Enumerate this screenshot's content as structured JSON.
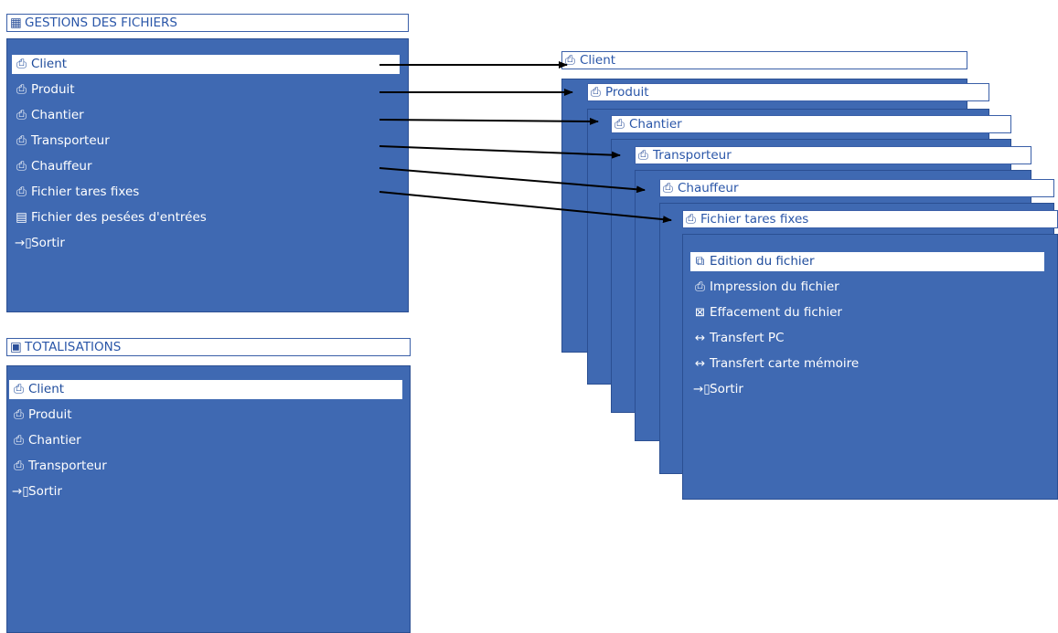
{
  "colors": {
    "panel": "#3f69b2",
    "title_text": "#2a56a8",
    "selection": "#ffffff",
    "arrow": "#000000"
  },
  "gestions": {
    "title": "GESTIONS DES FICHIERS",
    "title_icon": "files-icon",
    "items": [
      {
        "label": "Client",
        "icon": "folder-icon"
      },
      {
        "label": "Produit",
        "icon": "folder-icon"
      },
      {
        "label": "Chantier",
        "icon": "folder-icon"
      },
      {
        "label": "Transporteur",
        "icon": "folder-icon"
      },
      {
        "label": "Chauffeur",
        "icon": "folder-icon"
      },
      {
        "label": "Fichier tares fixes",
        "icon": "folder-icon"
      },
      {
        "label": "Fichier des pesées d'entrées",
        "icon": "file-list-icon"
      },
      {
        "label": "Sortir",
        "icon": "exit-icon"
      }
    ]
  },
  "totalisations": {
    "title": "TOTALISATIONS",
    "title_icon": "sum-icon",
    "items": [
      {
        "label": "Client",
        "icon": "folder-icon"
      },
      {
        "label": "Produit",
        "icon": "folder-icon"
      },
      {
        "label": "Chantier",
        "icon": "folder-icon"
      },
      {
        "label": "Transporteur",
        "icon": "folder-icon"
      },
      {
        "label": "Sortir",
        "icon": "exit-icon"
      }
    ]
  },
  "stack_titles": [
    "Client",
    "Produit",
    "Chantier",
    "Transporteur",
    "Chauffeur",
    "Fichier tares fixes"
  ],
  "submenu": {
    "items": [
      {
        "label": "Edition du fichier",
        "icon": "edit-file-icon"
      },
      {
        "label": "Impression du fichier",
        "icon": "printer-icon"
      },
      {
        "label": "Effacement du fichier",
        "icon": "erase-file-icon"
      },
      {
        "label": "Transfert PC",
        "icon": "transfer-pc-icon"
      },
      {
        "label": "Transfert carte mémoire",
        "icon": "transfer-card-icon"
      },
      {
        "label": "Sortir",
        "icon": "exit-icon"
      }
    ]
  }
}
